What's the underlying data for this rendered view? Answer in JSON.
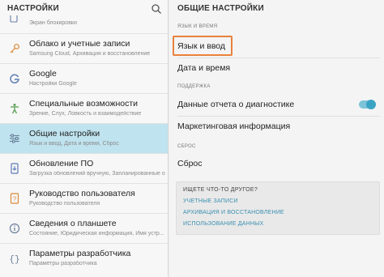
{
  "left": {
    "title": "НАСТРОЙКИ",
    "partial_sub": "Экран блокировки",
    "items": [
      {
        "title": "Облако и учетные записи",
        "sub": "Samsung Cloud, Архивация и восстановление",
        "icon": "key-icon"
      },
      {
        "title": "Google",
        "sub": "Настройки Google",
        "icon": "google-icon"
      },
      {
        "title": "Специальные возможности",
        "sub": "Зрение, Слух, Ловкость и взаимодействие",
        "icon": "accessibility-icon"
      },
      {
        "title": "Общие настройки",
        "sub": "Язык и ввод, Дата и время, Сброс",
        "icon": "sliders-icon",
        "selected": true
      },
      {
        "title": "Обновление ПО",
        "sub": "Загрузка обновлений вручную, Запланированные обно...",
        "icon": "software-update-icon"
      },
      {
        "title": "Руководство пользователя",
        "sub": "Руководство пользователя",
        "icon": "manual-icon"
      },
      {
        "title": "Сведения о планшете",
        "sub": "Состояние, Юридическая информация, Имя устр...",
        "icon": "info-icon"
      },
      {
        "title": "Параметры разработчика",
        "sub": "Параметры разработчика",
        "icon": "braces-icon"
      }
    ]
  },
  "right": {
    "title": "ОБЩИЕ НАСТРОЙКИ",
    "section_language": "ЯЗЫК И ВРЕМЯ",
    "row_language": "Язык и ввод",
    "row_datetime": "Дата и время",
    "section_support": "ПОДДЕРЖКА",
    "row_diagnostics": "Данные отчета о диагностике",
    "diagnostics_enabled": true,
    "row_marketing": "Маркетинговая информация",
    "section_reset": "СБРОС",
    "row_reset": "Сброс",
    "suggest": {
      "title": "ИЩЕТЕ ЧТО-ТО ДРУГОЕ?",
      "links": [
        "УЧЕТНЫЕ ЗАПИСИ",
        "АРХИВАЦИЯ И ВОССТАНОВЛЕНИЕ",
        "ИСПОЛЬЗОВАНИЕ ДАННЫХ"
      ]
    }
  },
  "colors": {
    "selected_bg": "#bfe3ef",
    "highlight": "#e8813d",
    "accent": "#3aa3c4",
    "link": "#3b8fb0"
  }
}
